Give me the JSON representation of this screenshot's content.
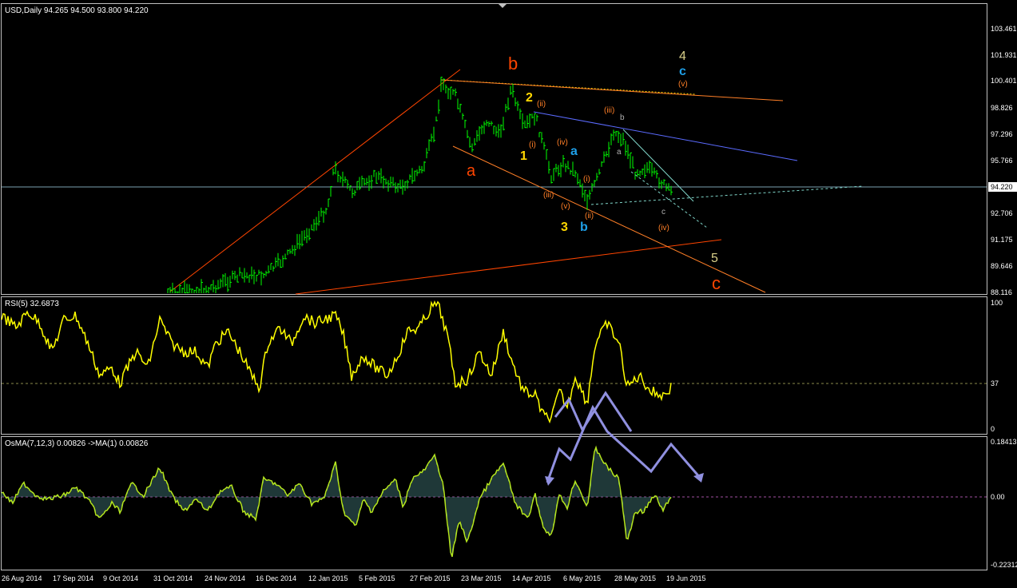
{
  "price_panel": {
    "header": "USD,Daily  94.265 94.500 93.800 94.220",
    "y_ticks": [
      "103.461",
      "101.931",
      "100.401",
      "98.826",
      "97.296",
      "95.766",
      "94.220",
      "92.706",
      "91.175",
      "89.646",
      "88.116"
    ],
    "current_price": "94.220",
    "colors": {
      "up": "#00ff00",
      "down": "#00ff00",
      "accent": "#ff4500"
    }
  },
  "wave_labels": {
    "b_big": "b",
    "a_big": "a",
    "c_big": "c",
    "four": "4",
    "five": "5",
    "c_blue": "c",
    "v_top": "(v)",
    "two": "2",
    "ii_top": "(ii)",
    "iii_right": "(iii)",
    "b_small": "b",
    "a_small": "a",
    "one": "1",
    "i_mid": "(i)",
    "iv_mid": "(iv)",
    "a_blue": "a",
    "i_right": "(i)",
    "iii_low": "(iii)",
    "v_low": "(v)",
    "ii_low": "(ii)",
    "three": "3",
    "b_blue": "b",
    "c_small": "c",
    "iv_low": "(iv)"
  },
  "rsi_panel": {
    "header": "RSI(5) 32.6873",
    "y_ticks": [
      "100",
      "37",
      "0"
    ]
  },
  "osma_panel": {
    "header": "OsMA(7,12,3) 0.00826  ->MA(1) 0.00826",
    "y_ticks": [
      "0.18413",
      "0.00",
      "-0.22312"
    ]
  },
  "x_axis": {
    "labels": [
      "26 Aug 2014",
      "17 Sep 2014",
      "9 Oct 2014",
      "31 Oct 2014",
      "24 Nov 2014",
      "16 Dec 2014",
      "12 Jan 2015",
      "5 Feb 2015",
      "27 Feb 2015",
      "23 Mar 2015",
      "14 Apr 2015",
      "6 May 2015",
      "28 May 2015",
      "19 Jun 2015"
    ]
  }
}
